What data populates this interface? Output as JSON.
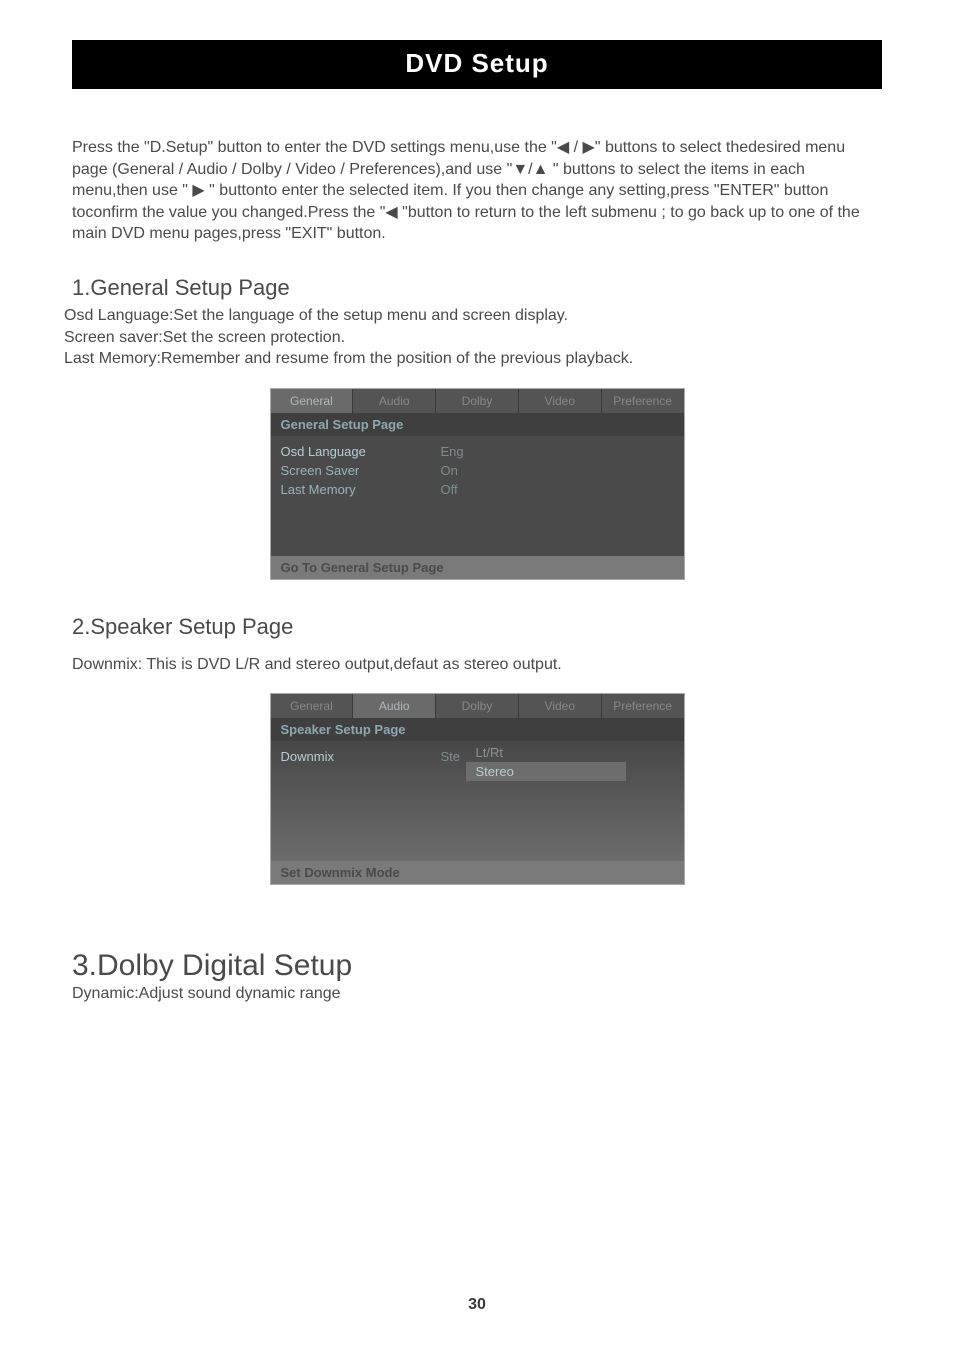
{
  "title": "DVD  Setup",
  "intro": {
    "p1a": "Press the \"D.Setup\" button to enter the DVD settings menu,use the \"",
    "arrows_lr": "◀ / ▶",
    "p1b": "\" buttons to select thedesired menu page (General / Audio / Dolby / Video / Preferences),and use \"",
    "arrows_du": "▼/▲",
    "p1c": " \" buttons to select the items in each menu,then use \" ",
    "arrow_r": "▶",
    "p1d": "  \" buttonto enter the selected item. If you then change any setting,press \"ENTER\" button toconfirm the value you changed.Press the \"",
    "arrow_l": "◀",
    "p1e": "  \"button to return to the left submenu ; to  go  back  up  to  one  of  the  main  DVD  menu  pages,press \"EXIT\" button."
  },
  "section1": {
    "heading": "1.General Setup Page",
    "l1": "Osd Language:Set the language of the setup menu and screen display.",
    "l2": "Screen saver:Set the screen protection.",
    "l3": "Last Memory:Remember and resume from the position of the previous playback."
  },
  "fig1": {
    "tabs": [
      "General",
      "Audio",
      "Dolby",
      "Video",
      "Preference"
    ],
    "active_tab_index": 0,
    "panel_title": "General  Setup  Page",
    "rows": [
      {
        "label": "Osd  Language",
        "value": "Eng"
      },
      {
        "label": "Screen  Saver",
        "value": "On"
      },
      {
        "label": "Last  Memory",
        "value": "Off"
      }
    ],
    "footer": "Go  To  General  Setup  Page"
  },
  "section2": {
    "heading": "2.Speaker Setup Page",
    "l1": "Downmix: This is DVD L/R and stereo output,defaut as stereo output."
  },
  "fig2": {
    "tabs": [
      "General",
      "Audio",
      "Dolby",
      "Video",
      "Preference"
    ],
    "active_tab_index": 1,
    "panel_title": "Speaker  Setup  Page",
    "rows": [
      {
        "label": "Downmix",
        "value": "Ste"
      }
    ],
    "submenu": [
      "Lt/Rt",
      "Stereo"
    ],
    "submenu_hl_index": 1,
    "footer": "Set  Downmix  Mode"
  },
  "section3": {
    "heading": "3.Dolby Digital Setup",
    "l1": "Dynamic:Adjust sound dynamic range"
  },
  "page_number": "30"
}
